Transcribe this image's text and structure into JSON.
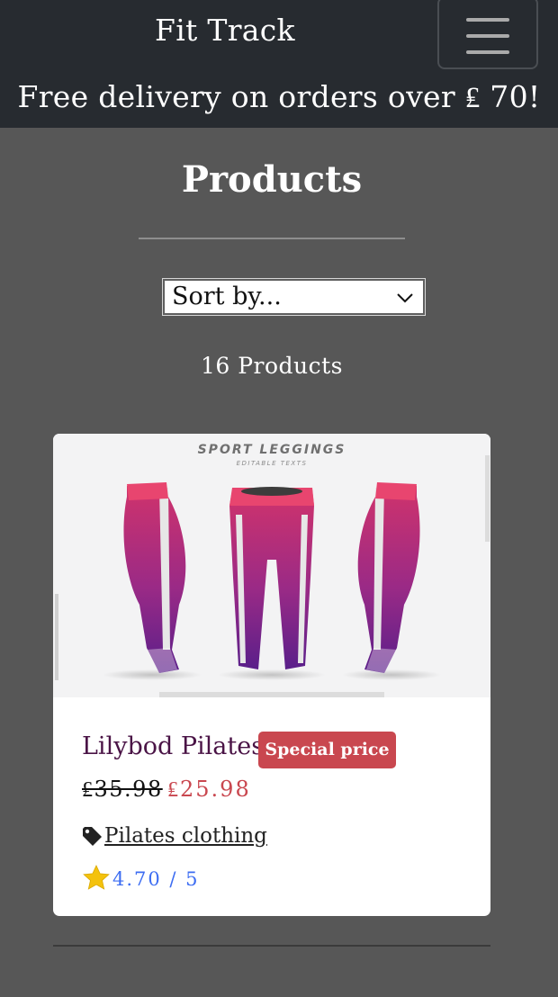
{
  "navbar": {
    "brand": "Fit Track",
    "menu_icon": "hamburger-icon",
    "promo": "Free delivery on orders over ₤ 70!"
  },
  "main": {
    "title": "Products",
    "sort": {
      "selected": "Sort by..."
    },
    "count_text": "16 Products"
  },
  "product": {
    "image": {
      "caption": "SPORT LEGGINGS",
      "subcaption": "EDITABLE TEXTS"
    },
    "name": "Lilybod Pilates",
    "badge": "Special price",
    "old_price": "₤35.98",
    "new_price": "₤25.98",
    "tag_icon": "tag-icon",
    "category": "Pilates clothing",
    "star_icon": "star-icon",
    "rating": "4.70 / 5"
  },
  "colors": {
    "nav_bg": "#272b30",
    "page_bg": "#575757",
    "badge_bg": "#c9474f",
    "price_accent": "#c9474f",
    "rating_text": "#3d6df2",
    "product_name": "#4a1446",
    "star": "#f4c20d"
  }
}
